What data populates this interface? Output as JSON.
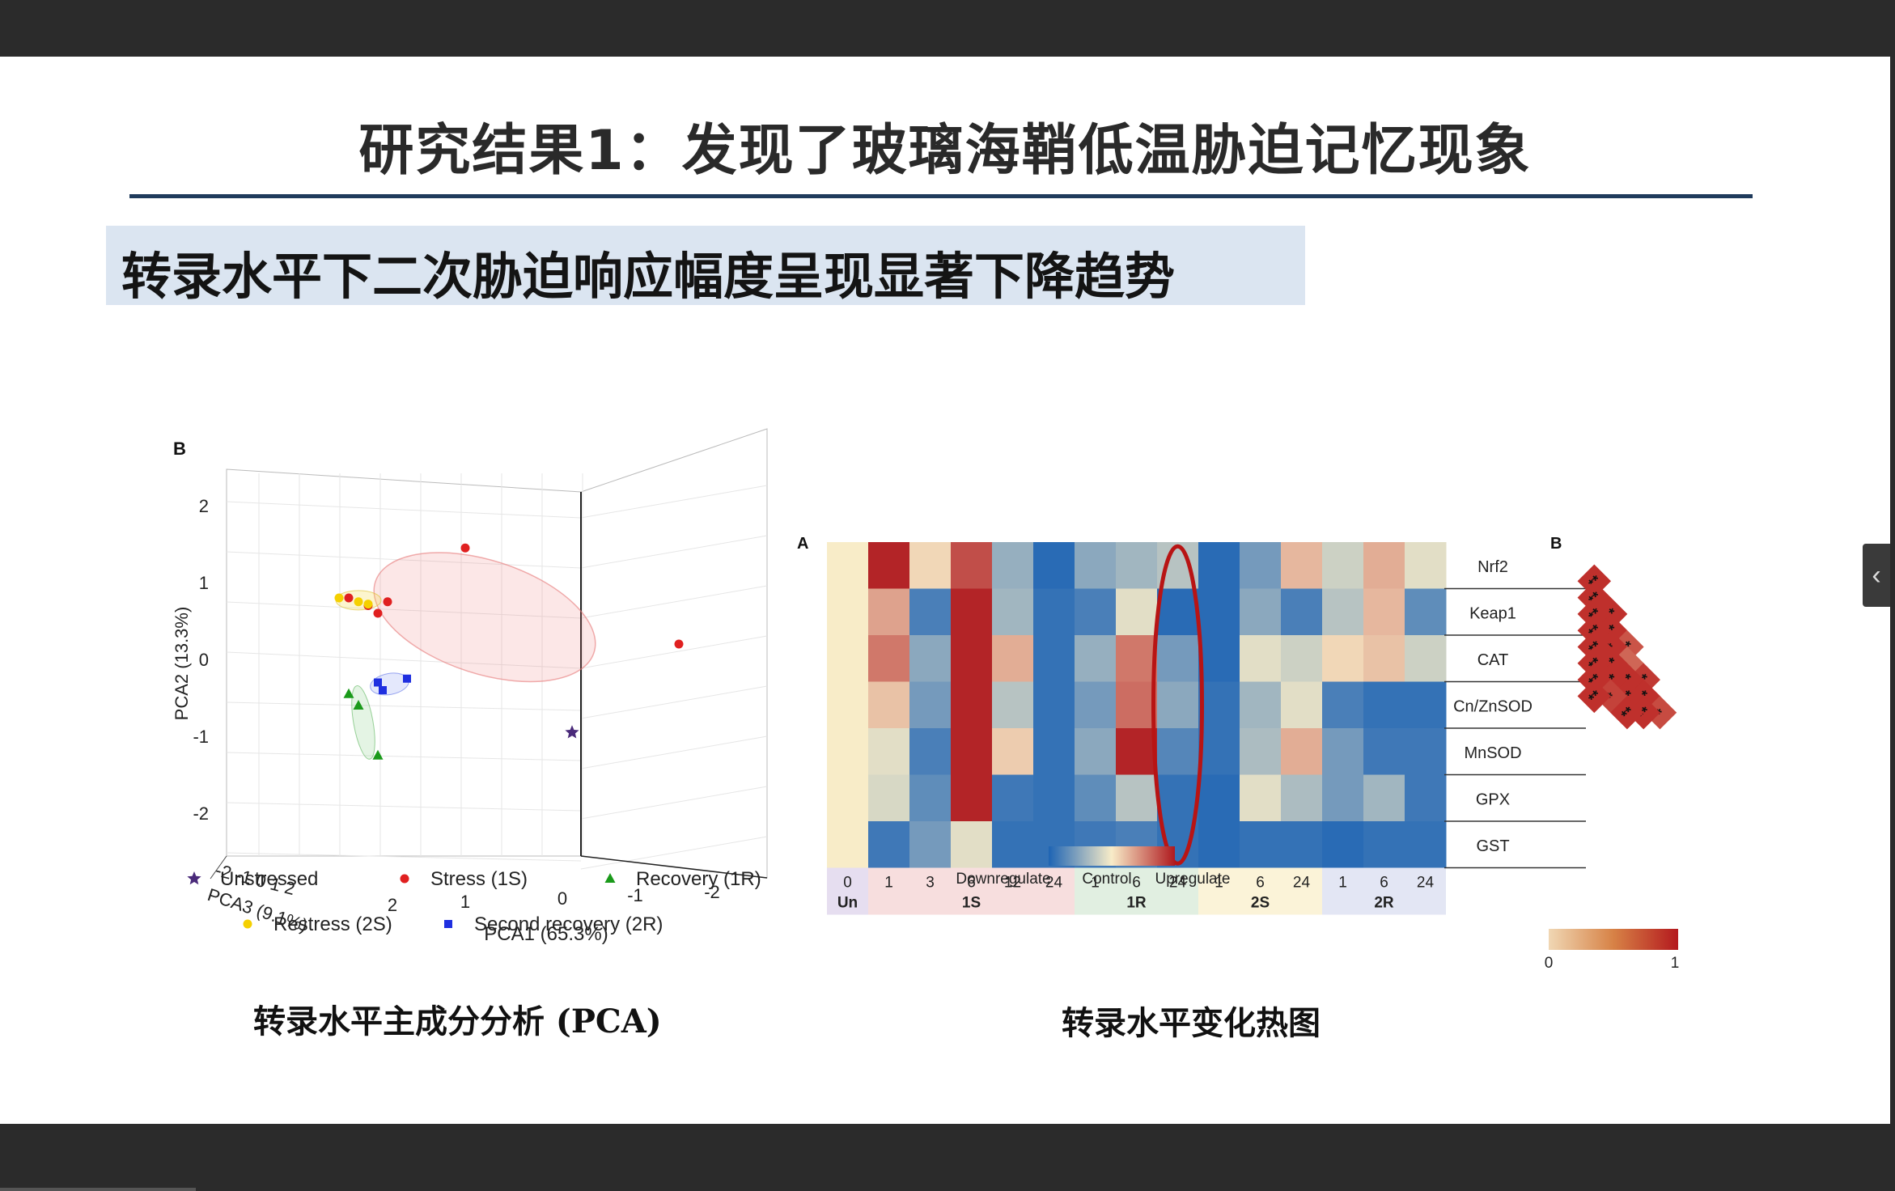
{
  "slide": {
    "title": "研究结果1：发现了玻璃海鞘低温胁迫记忆现象",
    "subtitle": "转录水平下二次胁迫响应幅度呈现显著下降趋势",
    "caption_left": "转录水平主成分分析 (PCA)",
    "caption_right": "转录水平变化热图"
  },
  "viewer": {
    "side_handle_icon": "chevron-left-icon"
  },
  "colors": {
    "title_rule": "#1f3b5c",
    "subtitle_bg": "#dbe5f1",
    "stress": "#e02020",
    "restress": "#f5d000",
    "recovery": "#1a9a1a",
    "second_recovery": "#1f2fe0",
    "unstressed": "#4a2a7a"
  },
  "chart_data": [
    {
      "type": "scatter",
      "panel_label": "B",
      "xlabel": "PCA1 (65.3%)",
      "ylabel": "PCA2 (13.3%)",
      "zlabel": "PCA3 (9.1%)",
      "y_ticks": [
        "2",
        "1",
        "0",
        "-1",
        "-2"
      ],
      "x_ticks": [
        "2",
        "1",
        "0",
        "-1",
        "-2"
      ],
      "z_ticks": "-2 -1 0 1 2",
      "series": [
        {
          "name": "Unstressed",
          "marker": "star",
          "color": "#4a2a7a",
          "points": [
            [
              -0.1,
              -0.95,
              0.0
            ]
          ]
        },
        {
          "name": "Stress (1S)",
          "marker": "circle",
          "color": "#e02020",
          "points": [
            [
              1.0,
              1.45,
              0.0
            ],
            [
              2.2,
              0.8,
              0.0
            ],
            [
              2.0,
              0.7,
              0.0
            ],
            [
              1.9,
              0.6,
              0.0
            ],
            [
              1.8,
              0.75,
              0.0
            ],
            [
              -1.2,
              0.2,
              0.0
            ]
          ]
        },
        {
          "name": "Recovery (1R)",
          "marker": "triangle",
          "color": "#1a9a1a",
          "points": [
            [
              2.2,
              -0.45,
              0.0
            ],
            [
              2.1,
              -0.6,
              0.0
            ],
            [
              1.9,
              -1.25,
              0.0
            ]
          ]
        },
        {
          "name": "Restress (2S)",
          "marker": "circle",
          "color": "#f5d000",
          "points": [
            [
              2.3,
              0.8,
              0.0
            ],
            [
              2.1,
              0.75,
              0.0
            ],
            [
              2.0,
              0.72,
              0.0
            ]
          ]
        },
        {
          "name": "Second recovery (2R)",
          "marker": "square",
          "color": "#1f2fe0",
          "points": [
            [
              1.9,
              -0.3,
              0.0
            ],
            [
              1.85,
              -0.4,
              0.0
            ],
            [
              1.6,
              -0.25,
              0.0
            ]
          ]
        }
      ],
      "legend": [
        "Unstressed",
        "Stress (1S)",
        "Recovery (1R)",
        "Restress (2S)",
        "Second recovery (2R)"
      ],
      "legend_position": "bottom"
    },
    {
      "type": "heatmap",
      "panel_label": "A",
      "genes": [
        "Nrf2",
        "Keap1",
        "CAT",
        "Cn/ZnSOD",
        "MnSOD",
        "GPX",
        "GST"
      ],
      "time_points": [
        "0",
        "1",
        "3",
        "6",
        "12",
        "24",
        "1",
        "6",
        "24",
        "1",
        "6",
        "24",
        "1",
        "6",
        "24"
      ],
      "groups": [
        {
          "label": "Un",
          "span": 1,
          "color": "#e6def0"
        },
        {
          "label": "1S",
          "span": 5,
          "color": "#f7dede"
        },
        {
          "label": "1R",
          "span": 3,
          "color": "#e1efe1"
        },
        {
          "label": "2S",
          "span": 3,
          "color": "#fbf3d8"
        },
        {
          "label": "2R",
          "span": 3,
          "color": "#e3e6f4"
        }
      ],
      "values": [
        [
          0,
          0.95,
          0.1,
          0.75,
          -0.45,
          -0.95,
          -0.5,
          -0.4,
          -0.3,
          -0.95,
          -0.6,
          0.25,
          -0.2,
          0.3,
          -0.1
        ],
        [
          0,
          0.35,
          -0.8,
          0.95,
          -0.4,
          -0.9,
          -0.8,
          -0.1,
          -0.95,
          -0.95,
          -0.5,
          -0.8,
          -0.3,
          0.25,
          -0.7
        ],
        [
          0,
          0.55,
          -0.5,
          0.95,
          0.3,
          -0.9,
          -0.45,
          0.55,
          -0.6,
          -0.95,
          -0.1,
          -0.2,
          0.1,
          0.2,
          -0.2
        ],
        [
          0,
          0.2,
          -0.6,
          0.95,
          -0.3,
          -0.9,
          -0.6,
          0.6,
          -0.5,
          -0.9,
          -0.4,
          -0.1,
          -0.8,
          -0.9,
          -0.9
        ],
        [
          0,
          -0.1,
          -0.8,
          0.95,
          0.15,
          -0.9,
          -0.5,
          0.95,
          -0.75,
          -0.9,
          -0.35,
          0.3,
          -0.6,
          -0.85,
          -0.85
        ],
        [
          0,
          -0.15,
          -0.7,
          0.95,
          -0.85,
          -0.9,
          -0.7,
          -0.3,
          -0.9,
          -0.95,
          -0.1,
          -0.35,
          -0.6,
          -0.4,
          -0.85
        ],
        [
          0,
          -0.85,
          -0.6,
          -0.1,
          -0.9,
          -0.9,
          -0.85,
          -0.8,
          -0.9,
          -0.95,
          -0.9,
          -0.9,
          -0.95,
          -0.9,
          -0.9
        ]
      ],
      "scale_labels": [
        "Downregulate",
        "Control",
        "Upregulate"
      ],
      "highlighted_column": 8
    },
    {
      "type": "heatmap",
      "panel_label": "B",
      "shape": "triangular correlation matrix",
      "scale_min": "0",
      "scale_max": "1",
      "cells": [
        {
          "row": 0,
          "col": 0,
          "value": 0.9,
          "label": "**"
        },
        {
          "row": 1,
          "col": 0,
          "value": 0.9,
          "label": "**"
        },
        {
          "row": 1,
          "col": 1,
          "value": 0.9,
          "label": "**"
        },
        {
          "row": 2,
          "col": 0,
          "value": 0.9,
          "label": "**"
        },
        {
          "row": 2,
          "col": 1,
          "value": 0.9,
          "label": "**"
        },
        {
          "row": 2,
          "col": 2,
          "value": 0.7,
          "label": "**"
        },
        {
          "row": 3,
          "col": 0,
          "value": 0.9,
          "label": "**"
        },
        {
          "row": 3,
          "col": 1,
          "value": 0.9,
          "label": "*"
        },
        {
          "row": 3,
          "col": 2,
          "value": 0.6,
          "label": ""
        },
        {
          "row": 3,
          "col": 3,
          "value": 0.85,
          "label": "**"
        },
        {
          "row": 4,
          "col": 0,
          "value": 0.9,
          "label": "**"
        },
        {
          "row": 4,
          "col": 1,
          "value": 0.9,
          "label": "**"
        },
        {
          "row": 4,
          "col": 2,
          "value": 0.9,
          "label": "**"
        },
        {
          "row": 4,
          "col": 3,
          "value": 0.9,
          "label": "**"
        },
        {
          "row": 4,
          "col": 4,
          "value": 0.75,
          "label": "*"
        },
        {
          "row": 5,
          "col": 0,
          "value": 0.9,
          "label": "**"
        },
        {
          "row": 5,
          "col": 1,
          "value": 0.9,
          "label": "**"
        },
        {
          "row": 5,
          "col": 2,
          "value": 0.9,
          "label": "**"
        },
        {
          "row": 5,
          "col": 3,
          "value": 0.9,
          "label": "**"
        },
        {
          "row": 6,
          "col": 0,
          "value": 0.9,
          "label": "**"
        },
        {
          "row": 6,
          "col": 1,
          "value": 0.8,
          "label": "*"
        },
        {
          "row": 6,
          "col": 2,
          "value": 0.9,
          "label": "**"
        },
        {
          "row": 7,
          "col": 0,
          "value": 0.9,
          "label": "**"
        }
      ]
    }
  ]
}
